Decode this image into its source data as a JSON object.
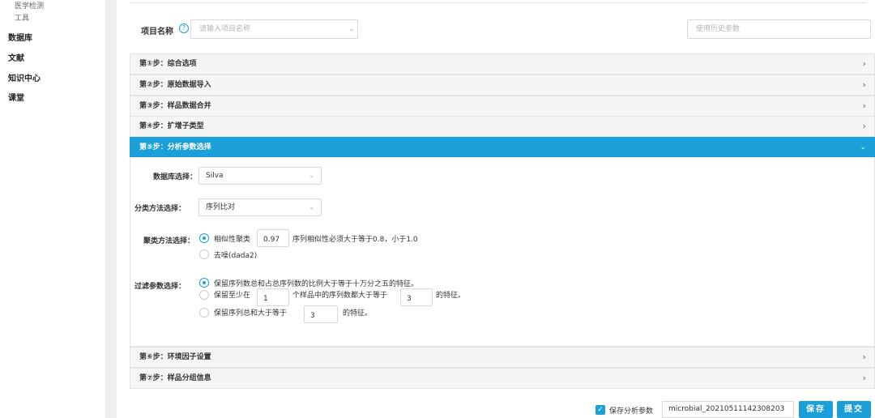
{
  "sidebar": {
    "sub_items": [
      "医学检测",
      "工具"
    ],
    "categories": [
      "数据库",
      "文献",
      "知识中心",
      "课堂"
    ]
  },
  "form": {
    "project_label": "项目名称",
    "help_icon": "?",
    "colon": ":",
    "project_placeholder": "请输入项目名称",
    "history_placeholder": "使用历史参数"
  },
  "steps": [
    {
      "label": "第①步：综合选项"
    },
    {
      "label": "第②步：原始数据导入"
    },
    {
      "label": "第③步：样品数据合并"
    },
    {
      "label": "第④步：扩增子类型"
    },
    {
      "label": "第⑤步：分析参数选择"
    },
    {
      "label": "第⑥步：环境因子设置"
    },
    {
      "label": "第⑦步：样品分组信息"
    }
  ],
  "step5": {
    "db_label": "数据库选择：",
    "db_value": "Silva",
    "class_label": "分类方法选择：",
    "class_value": "序列比对",
    "cluster_label": "聚类方法选择：",
    "cluster_opt1": "相似性聚类",
    "cluster_value": "0.97",
    "cluster_note": "序列相似性必须大于等于0.8，小于1.0",
    "cluster_opt2": "去噪(dada2)",
    "filter_label": "过滤参数选择：",
    "filter_opt1": "保留序列数总和占总序列数的比例大于等于十万分之五的特征。",
    "filter_opt2_a": "保留至少在",
    "filter_opt2_v1": "1",
    "filter_opt2_b": "个样品中的序列数都大于等于",
    "filter_opt2_v2": "3",
    "filter_opt2_c": "的特征。",
    "filter_opt3_a": "保留序列总和大于等于",
    "filter_opt3_v": "3",
    "filter_opt3_b": "的特征。"
  },
  "footer": {
    "save_params_label": "保存分析参数",
    "save_name": "microbial_20210511142308203",
    "save_button": "保存",
    "submit_button": "提交"
  },
  "colors": {
    "accent": "#1a9fd9"
  },
  "icons": {
    "expand": "chevron-right-icon",
    "collapse": "chevron-down-icon"
  }
}
